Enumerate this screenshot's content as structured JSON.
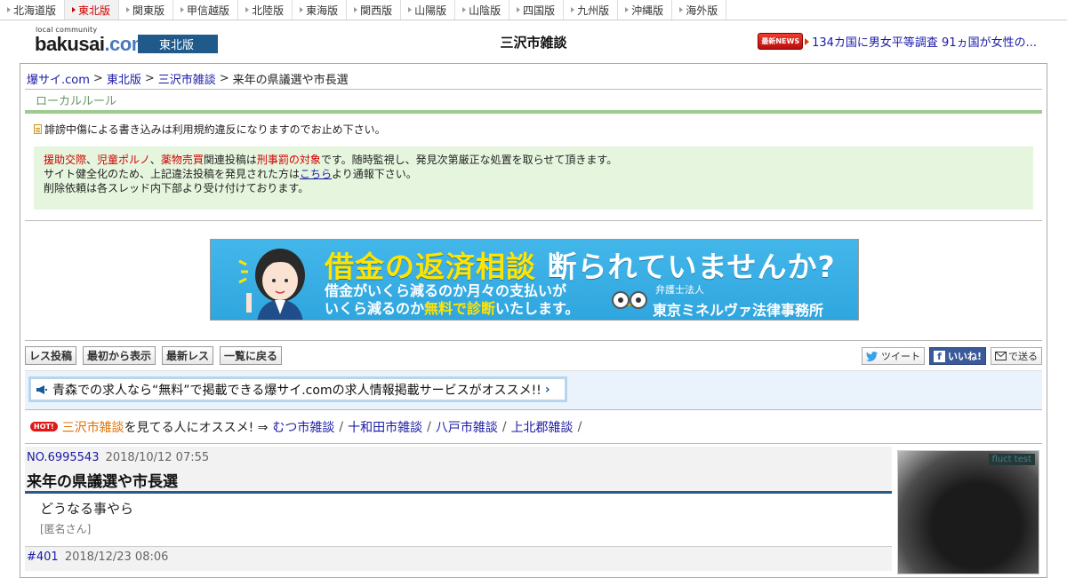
{
  "regions": [
    {
      "label": "北海道版",
      "active": false
    },
    {
      "label": "東北版",
      "active": true
    },
    {
      "label": "関東版",
      "active": false
    },
    {
      "label": "甲信越版",
      "active": false
    },
    {
      "label": "北陸版",
      "active": false
    },
    {
      "label": "東海版",
      "active": false
    },
    {
      "label": "関西版",
      "active": false
    },
    {
      "label": "山陽版",
      "active": false
    },
    {
      "label": "山陰版",
      "active": false
    },
    {
      "label": "四国版",
      "active": false
    },
    {
      "label": "九州版",
      "active": false
    },
    {
      "label": "沖縄版",
      "active": false
    },
    {
      "label": "海外版",
      "active": false
    }
  ],
  "header": {
    "logo_small": "local community",
    "logo_name": "bakusai",
    "logo_dot": ".com",
    "region_badge": "東北版",
    "board_title": "三沢市雑談",
    "news_badge": "最新NEWS",
    "news_text": "134カ国に男女平等調査 91ヵ国が女性の..."
  },
  "breadcrumb": {
    "home": "爆サイ.com",
    "region": "東北版",
    "board": "三沢市雑談",
    "current": "来年の県議選や市長選",
    "sep": ">"
  },
  "rules": {
    "title": "ローカルルール",
    "warning": "誹謗中傷による書き込みは利用規約違反になりますのでお止め下さい。",
    "term1": "援助交際",
    "comma1": "、",
    "term2": "児童ポルノ",
    "comma2": "、",
    "term3": "薬物売買",
    "text1": "関連投稿は",
    "term4": "刑事罰の対象",
    "text2": "です。随時監視し、発見次第厳正な処置を取らせて頂きます。",
    "line2_a": "サイト健全化のため、上記違法投稿を発見された方は",
    "line2_link": "こちら",
    "line2_b": "より通報下さい。",
    "line3": "削除依頼は各スレッド内下部より受け付けております。"
  },
  "ad": {
    "headline_yellow": "借金の返済相談",
    "headline_white": "断られていませんか?",
    "sub1": "借金がいくら減るのか月々の支払いが",
    "sub2a": "いくら減るのか",
    "sub2b": "無料で診断",
    "sub2c": "いたします。",
    "firm_small": "弁護士法人",
    "firm_big": "東京ミネルヴァ法律事務所"
  },
  "toolbar": {
    "post": "レス投稿",
    "from_start": "最初から表示",
    "latest": "最新レス",
    "back": "一覧に戻る",
    "tweet": "ツイート",
    "like": "いいね!",
    "send": "で送る"
  },
  "jobs": {
    "text": "青森での求人なら“無料”で掲載できる爆サイ.comの求人情報掲載サービスがオススメ!!"
  },
  "related": {
    "hot": "HOT!",
    "current": "三沢市雑談",
    "prompt": "を見てる人にオススメ! ⇒",
    "boards": [
      "むつ市雑談",
      "十和田市雑談",
      "八戸市雑談",
      "上北郡雑談"
    ],
    "sep": "/"
  },
  "thread": {
    "no": "NO.6995543",
    "date": "2018/10/12 07:55",
    "title": "来年の県議選や市長選",
    "body": "どうなる事やら",
    "author": "[匿名さん]",
    "next_no": "#401",
    "next_date": "2018/12/23 08:06"
  },
  "side_ad": {
    "tag": "fluct test"
  },
  "colors": {
    "region_badge": "#1f5a8b",
    "rule_box": "#e6f6de",
    "rule_line": "#9ccb8e",
    "link": "#1a1aa6",
    "warn_red": "#d00000"
  }
}
